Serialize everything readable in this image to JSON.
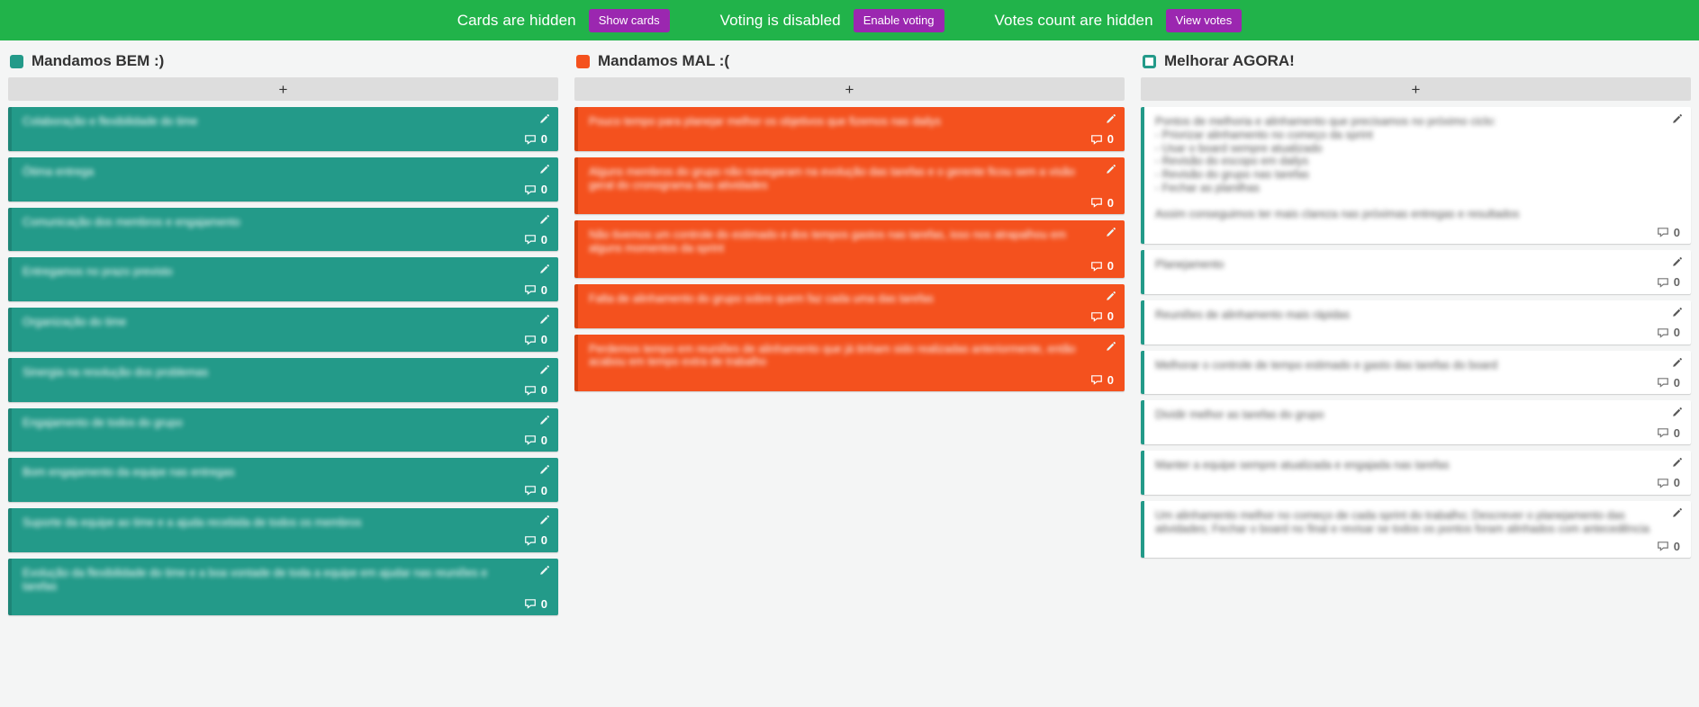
{
  "toolbar": {
    "cards_status": "Cards are hidden",
    "cards_button": "Show cards",
    "voting_status": "Voting is disabled",
    "voting_button": "Enable voting",
    "votes_status": "Votes count are hidden",
    "votes_button": "View votes",
    "bar_color": "#21b34a",
    "button_color": "#9b27b0"
  },
  "board": {
    "add_label": "+",
    "columns": [
      {
        "title": "Mandamos BEM :)",
        "swatch": "filled-teal",
        "accent": "#239a89",
        "cards": [
          {
            "text": "Colaboração e flexibilidade do time",
            "comments": "0"
          },
          {
            "text": "Ótima entrega",
            "comments": "0"
          },
          {
            "text": "Comunicação dos membros e engajamento",
            "comments": "0"
          },
          {
            "text": "Entregamos no prazo previsto",
            "comments": "0"
          },
          {
            "text": "Organização do time",
            "comments": "0"
          },
          {
            "text": "Sinergia na resolução dos problemas",
            "comments": "0"
          },
          {
            "text": "Engajamento de todos do grupo",
            "comments": "0"
          },
          {
            "text": "Bom engajamento da equipe nas entregas",
            "comments": "0"
          },
          {
            "text": "Suporte da equipe ao time e a ajuda recebida de todos os membros",
            "comments": "0"
          },
          {
            "text": "Evolução da flexibilidade do time e a boa vontade de toda a equipe em ajudar nas reuniões e tarefas",
            "comments": "0"
          }
        ]
      },
      {
        "title": "Mandamos MAL :(",
        "swatch": "filled-orange",
        "accent": "#f4511e",
        "cards": [
          {
            "text": "Pouco tempo para planejar melhor os objetivos que fizemos nas dailys",
            "comments": "0"
          },
          {
            "text": "Alguns membros do grupo não navegaram na evolução das tarefas e o gerente ficou sem a visão geral do cronograma das atividades",
            "comments": "0"
          },
          {
            "text": "Não tivemos um controle do estimado e dos tempos gastos nas tarefas, isso nos atrapalhou em alguns momentos da sprint",
            "comments": "0"
          },
          {
            "text": "Falta de alinhamento do grupo sobre quem faz cada uma das tarefas",
            "comments": "0"
          },
          {
            "text": "Perdemos tempo em reuniões de alinhamento que já tinham sido realizadas anteriormente, então acabou em tempo extra de trabalho",
            "comments": "0"
          }
        ]
      },
      {
        "title": "Melhorar AGORA!",
        "swatch": "outline-teal",
        "accent": "#239a89",
        "cards": [
          {
            "text": "Pontos de melhoria e alinhamento que precisamos no próximo ciclo:\n- Priorizar alinhamento no começo da sprint\n- Usar o board sempre atualizado\n- Revisão do escopo em dailys\n- Revisão do grupo nas tarefas\n- Fechar as planilhas\n\nAssim conseguimos ter mais clareza nas próximas entregas e resultados",
            "comments": "0"
          },
          {
            "text": "Planejamento",
            "comments": "0"
          },
          {
            "text": "Reuniões de alinhamento mais rápidas",
            "comments": "0"
          },
          {
            "text": "Melhorar o controle de tempo estimado e gasto das tarefas do board",
            "comments": "0"
          },
          {
            "text": "Dividir melhor as tarefas do grupo",
            "comments": "0"
          },
          {
            "text": "Manter a equipe sempre atualizada e engajada nas tarefas",
            "comments": "0"
          },
          {
            "text": "Um alinhamento melhor no começo de cada sprint do trabalho; Descrever o planejamento das atividades; Fechar o board no final e revisar se todos os pontos foram alinhados com antecedência",
            "comments": "0"
          }
        ]
      }
    ]
  }
}
